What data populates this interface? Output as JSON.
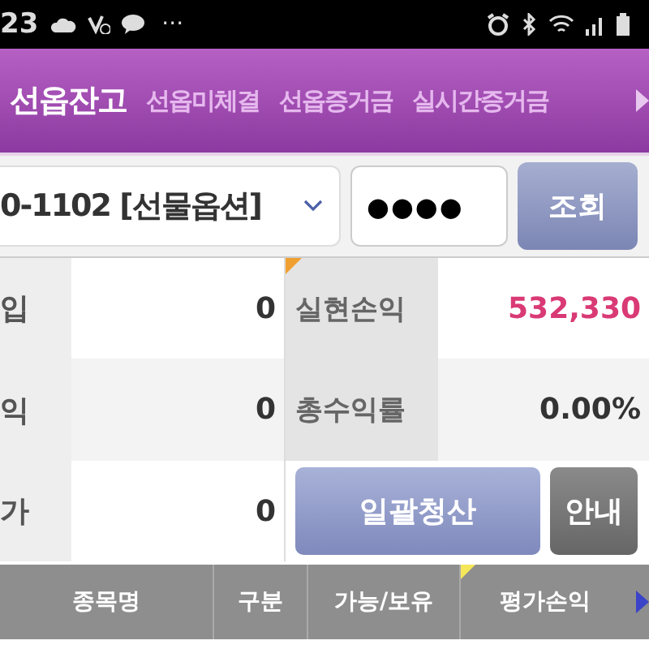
{
  "status_bar": {
    "time": "23",
    "more": "···"
  },
  "tabs": [
    {
      "label": "선옵잔고",
      "selected": true
    },
    {
      "label": "선옵미체결",
      "selected": false
    },
    {
      "label": "선옵증거금",
      "selected": false
    },
    {
      "label": "실시간증거금",
      "selected": false
    }
  ],
  "account": {
    "value": "0-1102 [선물옵션]"
  },
  "password": {
    "value": "●●●●"
  },
  "query_button": "조회",
  "summary": [
    {
      "label": "입",
      "value": "0",
      "right": {
        "kind": "field",
        "label": "실현손익",
        "value": "532,330",
        "highlighted": true,
        "flagged": true
      }
    },
    {
      "label": "익",
      "value": "0",
      "right": {
        "kind": "field",
        "label": "총수익률",
        "value": "0.00%",
        "highlighted": false,
        "flagged": false
      }
    },
    {
      "label": "가",
      "value": "0",
      "right": {
        "kind": "buttons",
        "buttons": [
          {
            "label": "일괄청산",
            "kind": "primary"
          },
          {
            "label": "안내",
            "kind": "secondary"
          }
        ]
      }
    }
  ],
  "columns": [
    {
      "label": "종목명",
      "flagged": false
    },
    {
      "label": "구분",
      "flagged": false
    },
    {
      "label": "가능/보유",
      "flagged": false
    },
    {
      "label": "평가손익",
      "flagged": true
    }
  ]
}
